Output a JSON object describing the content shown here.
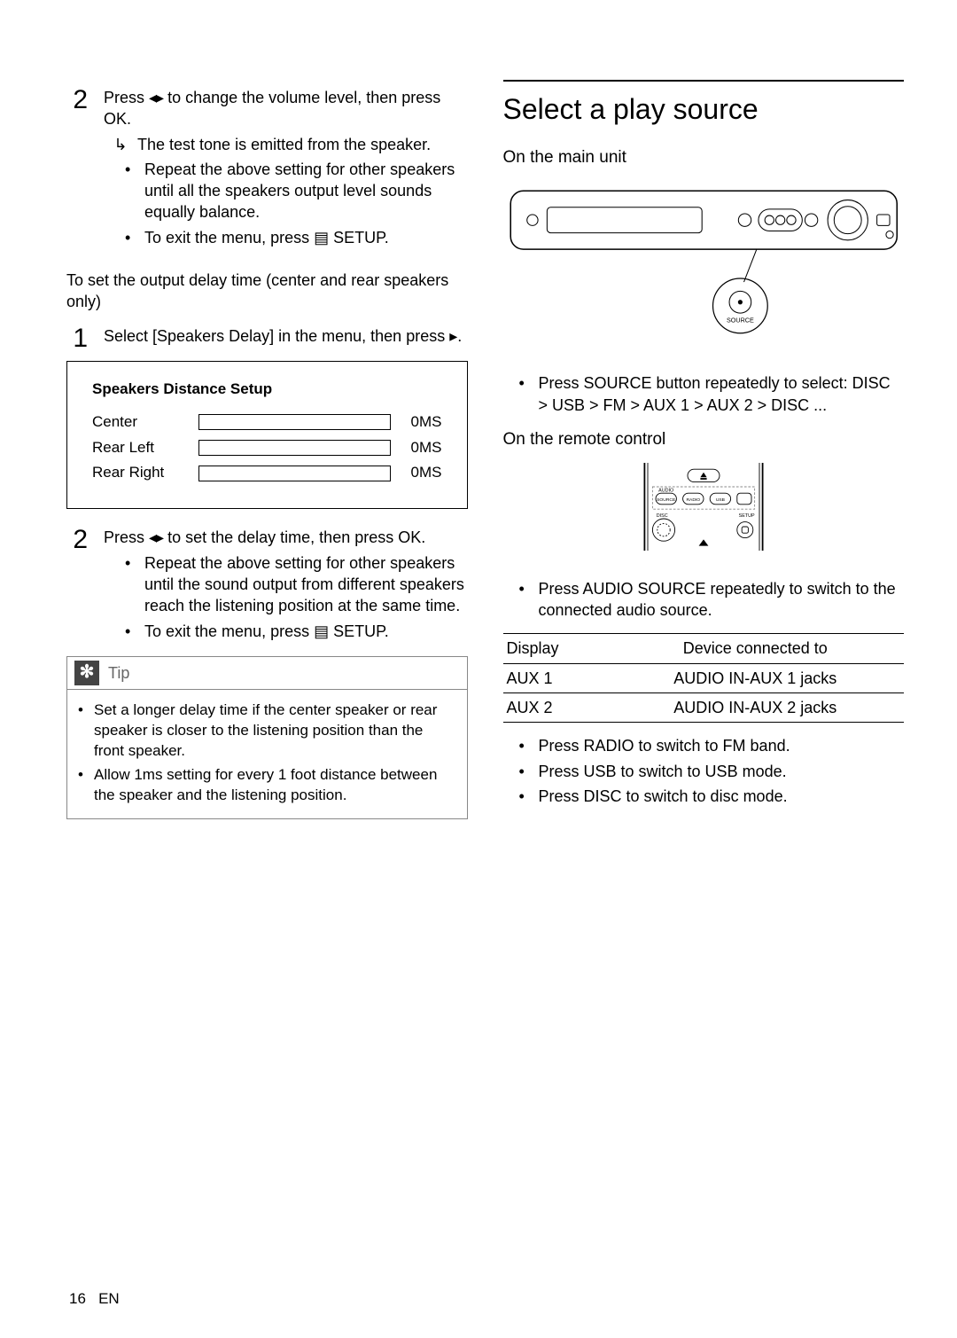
{
  "left": {
    "step2": {
      "text1": "Press ",
      "text2": " to change the volume level, then press OK.",
      "tone": "The test tone is emitted from the speaker.",
      "bul1": "Repeat the above setting for other speakers until all the speakers output level sounds equally balance.",
      "bul2a": "To exit the menu, press ",
      "bul2b": " SETUP."
    },
    "para_delay": "To set the output delay time (center and rear speakers only)",
    "step1": {
      "text1": "Select [Speakers Delay] in the menu, then press ",
      "text2": "."
    },
    "setup": {
      "title": "Speakers Distance Setup",
      "r1_label": "Center",
      "r1_val": "0MS",
      "r2_label": "Rear Left",
      "r2_val": "0MS",
      "r3_label": "Rear Right",
      "r3_val": "0MS"
    },
    "step2b": {
      "text1": "Press ",
      "text2": " to set the delay time, then press OK.",
      "bul1": "Repeat the above setting for other speakers until the sound output from different speakers reach the listening position at the same time.",
      "bul2a": "To exit the menu, press ",
      "bul2b": " SETUP."
    },
    "tip": {
      "label": "Tip",
      "t1": "Set a longer delay time if the center speaker or rear speaker is closer to the listening position than the front speaker.",
      "t2": "Allow 1ms setting for every 1 foot distance between the speaker and the listening position."
    }
  },
  "right": {
    "heading": "Select a play source",
    "sub1": "On the main unit",
    "source_label": "SOURCE",
    "bullet_source": "Press SOURCE button repeatedly to select: DISC > USB > FM > AUX 1 > AUX 2 >  DISC ...",
    "sub2": "On the remote control",
    "remote_labels": {
      "audio": "AUDIO",
      "source": "SOURCE",
      "radio": "RADIO",
      "usb": "USB",
      "disc": "DISC",
      "setup": "SETUP"
    },
    "bullet_audio": "Press AUDIO SOURCE repeatedly to switch to the connected audio source.",
    "table": {
      "h1": "Display",
      "h2": "Device connected to",
      "r1a": "AUX 1",
      "r1b": "AUDIO IN-AUX 1 jacks",
      "r2a": "AUX 2",
      "r2b": "AUDIO IN-AUX 2 jacks"
    },
    "b_radio": "Press RADIO to switch to FM band.",
    "b_usb": "Press USB to switch to USB mode.",
    "b_disc": "Press DISC to switch to disc mode."
  },
  "footer": {
    "page": "16",
    "lang": "EN"
  }
}
